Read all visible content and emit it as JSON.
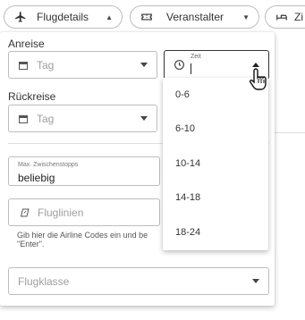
{
  "chips": [
    {
      "label": "Flugdetails",
      "icon": "plane-icon"
    },
    {
      "label": "Veranstalter",
      "icon": "ticket-icon"
    },
    {
      "label": "Zi",
      "icon": "bed-icon"
    }
  ],
  "arrival": {
    "label": "Anreise",
    "date_placeholder": "Tag",
    "time_label": "Zeit",
    "time_value": ""
  },
  "return": {
    "label": "Rückreise",
    "date_placeholder": "Tag"
  },
  "stops": {
    "label": "Max. Zwischenstopps",
    "value": "beliebig"
  },
  "airlines": {
    "placeholder": "Fluglinien",
    "hint": "Gib hier die Airline Codes ein und be \"Enter\"."
  },
  "flight_class": {
    "placeholder": "Flugklasse"
  },
  "time_options": [
    "0-6",
    "6-10",
    "10-14",
    "14-18",
    "18-24"
  ],
  "colors": {
    "border": "#bdbdbd",
    "text": "#333333",
    "muted": "#9e9e9e"
  }
}
